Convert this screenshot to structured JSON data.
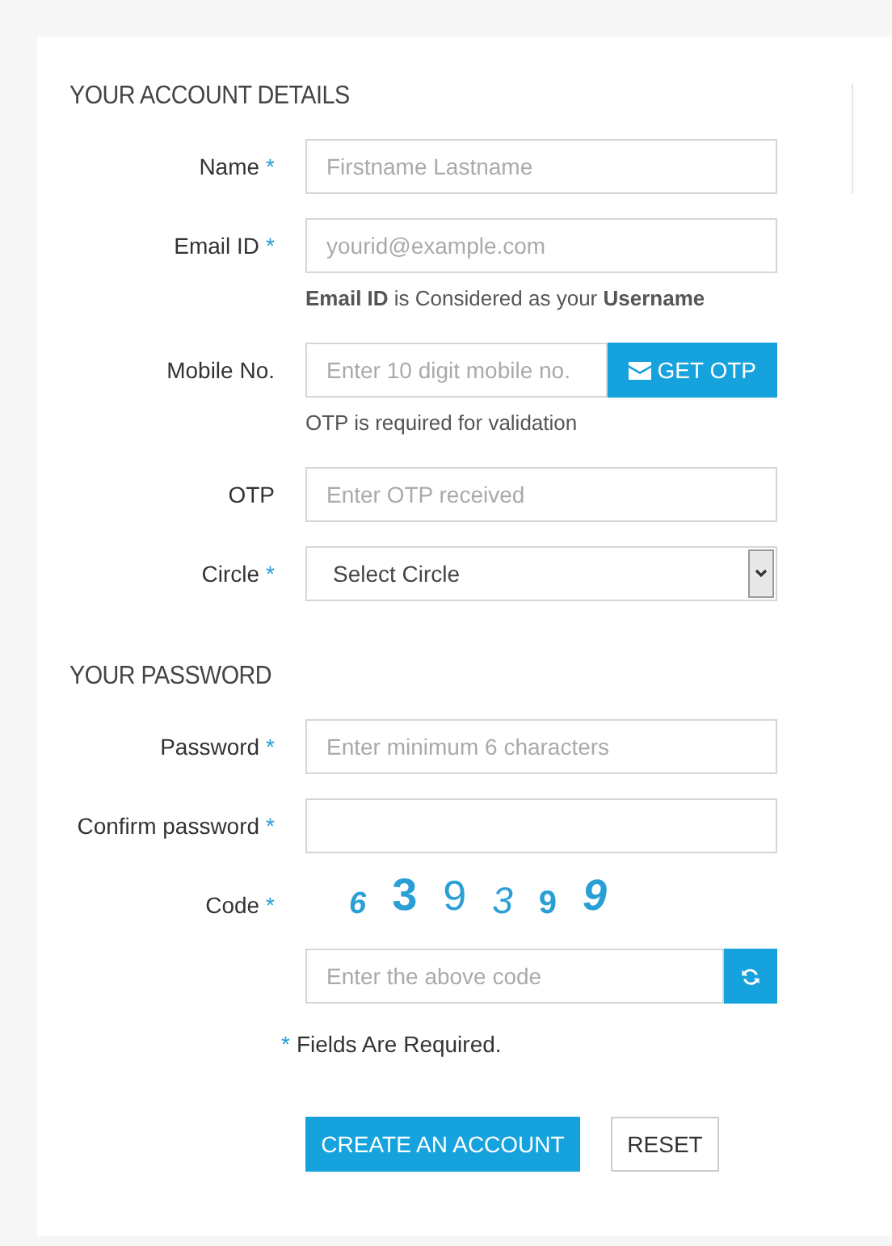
{
  "sections": [
    {
      "title": "YOUR ACCOUNT DETAILS",
      "fields": [
        {
          "kind": "text",
          "label": "Name",
          "required_mark": "*",
          "placeholder": "Firstname Lastname"
        },
        {
          "kind": "text",
          "label": "Email ID",
          "required_mark": "*",
          "placeholder": "yourid@example.com",
          "note": "**Email ID** is Considered as your **Username**"
        },
        {
          "kind": "addon",
          "label": "Mobile No.",
          "placeholder": "Enter 10 digit mobile no.",
          "button": "GET OTP",
          "note": "OTP is required for validation"
        },
        {
          "kind": "text",
          "label": "OTP",
          "placeholder": "Enter OTP received"
        },
        {
          "kind": "select",
          "label": "Circle",
          "required_mark": "*",
          "value": "Select Circle"
        }
      ]
    },
    {
      "title": "YOUR PASSWORD",
      "fields": [
        {
          "kind": "text",
          "label": "Password",
          "required_mark": "*",
          "placeholder": "Enter minimum 6 characters"
        },
        {
          "kind": "text",
          "label": "Confirm password",
          "required_mark": "*"
        },
        {
          "kind": "captcha",
          "label": "Code",
          "required_mark": "*",
          "digits": [
            "6",
            "3",
            "9",
            "3",
            "9",
            "9"
          ],
          "placeholder": "Enter the above code"
        }
      ]
    }
  ],
  "required_note": {
    "mark": "*",
    "text": "Fields Are Required."
  },
  "buttons": [
    {
      "kind": "primary",
      "label": "CREATE AN ACCOUNT"
    },
    {
      "kind": "secondary",
      "label": "RESET"
    }
  ]
}
